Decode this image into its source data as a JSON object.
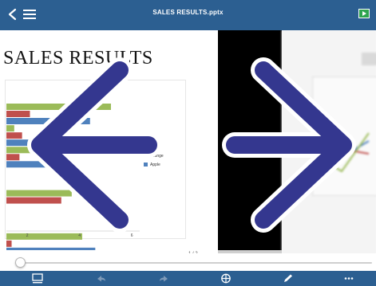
{
  "header": {
    "title": "SALES RESULTS.pptx"
  },
  "slide": {
    "title": "SALES RESULTS",
    "page_indicator": "1 / 2"
  },
  "chart_data": {
    "type": "bar",
    "orientation": "horizontal",
    "categories": [
      "",
      "",
      "",
      "",
      "",
      "",
      ""
    ],
    "series": [
      {
        "name": "Peach",
        "color": "#9bbb59",
        "values": [
          5.2,
          1.5,
          2.3,
          0.6,
          3.7,
          0.5,
          4.1
        ]
      },
      {
        "name": "Orange",
        "color": "#c0504d",
        "values": [
          2.1,
          1.8,
          1.7,
          0.4,
          3.3,
          0.3,
          1.4
        ]
      },
      {
        "name": "Apple",
        "color": "#4f81bd",
        "values": [
          4.4,
          3.2,
          2.8,
          0.8,
          1.2,
          0.4,
          4.6
        ]
      }
    ],
    "xticks": [
      "2",
      "4",
      "6"
    ],
    "xlim": [
      1.2,
      6.3
    ],
    "legend": "right",
    "legend_labels": [
      "Peach",
      "Orange",
      "Apple"
    ],
    "legend_label_visible": [
      "ach",
      "Orange",
      "Apple"
    ],
    "grid": false
  },
  "icons": {
    "back": "chevron-left-icon",
    "menu": "hamburger-menu-icon",
    "present": "present-play-icon",
    "slides": "slides-panel-icon",
    "undo": "undo-icon",
    "redo": "redo-icon",
    "insert": "crosshair-insert-icon",
    "pen": "pen-icon",
    "more": "more-dots-icon",
    "prev": "arrow-left-icon",
    "next": "arrow-right-icon"
  },
  "colors": {
    "bar_bg": "#2c5f91",
    "arrow_fill": "#34378f",
    "present_green": "#2ea44f"
  }
}
